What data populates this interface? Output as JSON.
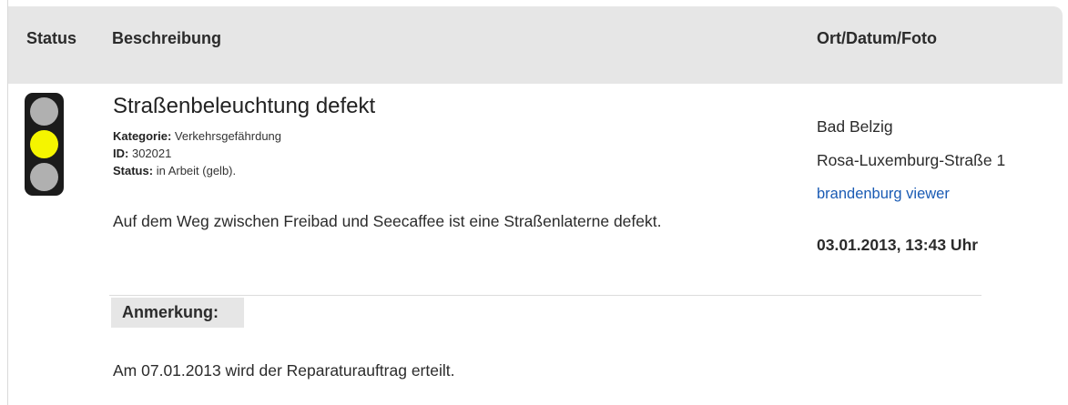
{
  "header": {
    "status": "Status",
    "beschreibung": "Beschreibung",
    "ort": "Ort/Datum/Foto"
  },
  "entry": {
    "title": "Straßenbeleuchtung defekt",
    "kategorie_label": "Kategorie:",
    "kategorie_value": "Verkehrsgefährdung",
    "id_label": "ID:",
    "id_value": "302021",
    "status_label": "Status:",
    "status_value": "in Arbeit (gelb).",
    "description": "Auf dem Weg zwischen Freibad und Seecaffee ist eine Straßenlaterne defekt.",
    "traffic_light": {
      "active": "yellow",
      "active_color": "#f5f500",
      "inactive_color": "#b0b0b0"
    }
  },
  "location": {
    "city": "Bad Belzig",
    "street": "Rosa-Luxemburg-Straße 1",
    "viewer_link": "brandenburg viewer",
    "datetime": "03.01.2013, 13:43 Uhr"
  },
  "note": {
    "label": "Anmerkung:",
    "text": "Am 07.01.2013 wird der Reparaturauftrag erteilt."
  }
}
